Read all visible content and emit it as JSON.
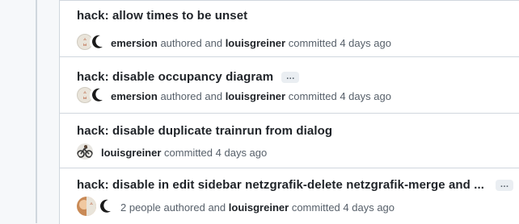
{
  "commits": [
    {
      "title": "hack: allow times to be unset",
      "has_ellipsis": false,
      "author": "emersion",
      "verb1": "authored and",
      "committer": "louisgreiner",
      "verb2": "committed",
      "time": "4 days ago",
      "avatars": [
        "kr-avatar",
        "moon-avatar"
      ]
    },
    {
      "title": "hack: disable occupancy diagram",
      "has_ellipsis": true,
      "ellipsis": "…",
      "author": "emersion",
      "verb1": "authored and",
      "committer": "louisgreiner",
      "verb2": "committed",
      "time": "4 days ago",
      "avatars": [
        "kr-avatar",
        "moon-avatar"
      ]
    },
    {
      "title": "hack: disable duplicate trainrun from dialog",
      "has_ellipsis": false,
      "committer": "louisgreiner",
      "verb2": "committed",
      "time": "4 days ago",
      "avatars": [
        "bike-avatar"
      ]
    },
    {
      "title": "hack: disable in edit sidebar netzgrafik-delete netzgrafik-merge and ...",
      "has_ellipsis": true,
      "ellipsis": "…",
      "author": "2 people",
      "verb1": "authored and",
      "committer": "louisgreiner",
      "verb2": "committed",
      "time": "4 days ago",
      "avatars": [
        "group-avatar",
        "moon-avatar"
      ]
    }
  ],
  "colors": {
    "title": "#1f2328",
    "muted": "#57606a",
    "border": "#d0d7de",
    "page_bg": "#f6f8fa"
  }
}
